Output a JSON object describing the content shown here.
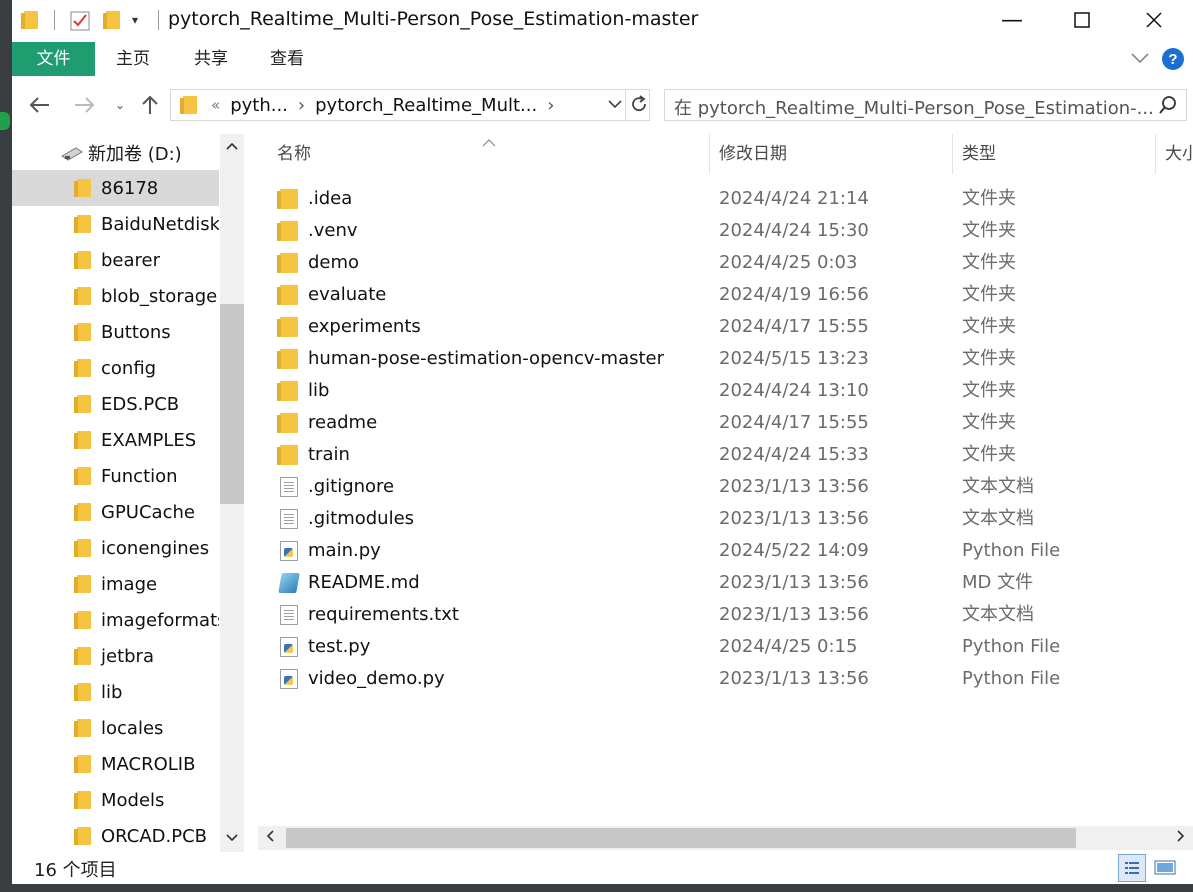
{
  "window": {
    "title": "pytorch_Realtime_Multi-Person_Pose_Estimation-master"
  },
  "ribbon": {
    "tabs": [
      {
        "label": "文件",
        "active": true
      },
      {
        "label": "主页",
        "active": false
      },
      {
        "label": "共享",
        "active": false
      },
      {
        "label": "查看",
        "active": false
      }
    ]
  },
  "address": {
    "overflow": "«",
    "crumb1": "pyth...",
    "crumb2": "pytorch_Realtime_Mult...",
    "separator": "›"
  },
  "search": {
    "placeholder": "在 pytorch_Realtime_Multi-Person_Pose_Estimation-..."
  },
  "nav": {
    "drive": "新加卷 (D:)",
    "items": [
      {
        "label": "86178",
        "selected": true
      },
      {
        "label": "BaiduNetdiskD",
        "selected": false
      },
      {
        "label": "bearer",
        "selected": false
      },
      {
        "label": "blob_storage",
        "selected": false
      },
      {
        "label": "Buttons",
        "selected": false
      },
      {
        "label": "config",
        "selected": false
      },
      {
        "label": "EDS.PCB",
        "selected": false
      },
      {
        "label": "EXAMPLES",
        "selected": false
      },
      {
        "label": "Function",
        "selected": false
      },
      {
        "label": "GPUCache",
        "selected": false
      },
      {
        "label": "iconengines",
        "selected": false
      },
      {
        "label": "image",
        "selected": false
      },
      {
        "label": "imageformats",
        "selected": false
      },
      {
        "label": "jetbra",
        "selected": false
      },
      {
        "label": "lib",
        "selected": false
      },
      {
        "label": "locales",
        "selected": false
      },
      {
        "label": "MACROLIB",
        "selected": false
      },
      {
        "label": "Models",
        "selected": false
      },
      {
        "label": "ORCAD.PCB",
        "selected": false
      }
    ]
  },
  "columns": {
    "name": "名称",
    "date": "修改日期",
    "type": "类型",
    "size": "大小"
  },
  "files": [
    {
      "name": ".idea",
      "date": "2024/4/24 21:14",
      "type": "文件夹",
      "icon": "folder-icon"
    },
    {
      "name": ".venv",
      "date": "2024/4/24 15:30",
      "type": "文件夹",
      "icon": "folder-icon"
    },
    {
      "name": "demo",
      "date": "2024/4/25 0:03",
      "type": "文件夹",
      "icon": "folder-icon"
    },
    {
      "name": "evaluate",
      "date": "2024/4/19 16:56",
      "type": "文件夹",
      "icon": "folder-icon"
    },
    {
      "name": "experiments",
      "date": "2024/4/17 15:55",
      "type": "文件夹",
      "icon": "folder-icon"
    },
    {
      "name": "human-pose-estimation-opencv-master",
      "date": "2024/5/15 13:23",
      "type": "文件夹",
      "icon": "folder-icon"
    },
    {
      "name": "lib",
      "date": "2024/4/24 13:10",
      "type": "文件夹",
      "icon": "folder-icon"
    },
    {
      "name": "readme",
      "date": "2024/4/17 15:55",
      "type": "文件夹",
      "icon": "folder-icon"
    },
    {
      "name": "train",
      "date": "2024/4/24 15:33",
      "type": "文件夹",
      "icon": "folder-icon"
    },
    {
      "name": ".gitignore",
      "date": "2023/1/13 13:56",
      "type": "文本文档",
      "icon": "text-file-icon"
    },
    {
      "name": ".gitmodules",
      "date": "2023/1/13 13:56",
      "type": "文本文档",
      "icon": "text-file-icon"
    },
    {
      "name": "main.py",
      "date": "2024/5/22 14:09",
      "type": "Python File",
      "icon": "python-file-icon"
    },
    {
      "name": "README.md",
      "date": "2023/1/13 13:56",
      "type": "MD 文件",
      "icon": "markdown-file-icon"
    },
    {
      "name": "requirements.txt",
      "date": "2023/1/13 13:56",
      "type": "文本文档",
      "icon": "text-file-icon"
    },
    {
      "name": "test.py",
      "date": "2024/4/25 0:15",
      "type": "Python File",
      "icon": "python-file-icon"
    },
    {
      "name": "video_demo.py",
      "date": "2023/1/13 13:56",
      "type": "Python File",
      "icon": "python-file-icon"
    }
  ],
  "status": {
    "count": "16 个项目"
  },
  "colors": {
    "accent": "#1f9c70",
    "selection": "#d9d9d9",
    "folder": "#f5c542",
    "help": "#1a6fd1"
  }
}
